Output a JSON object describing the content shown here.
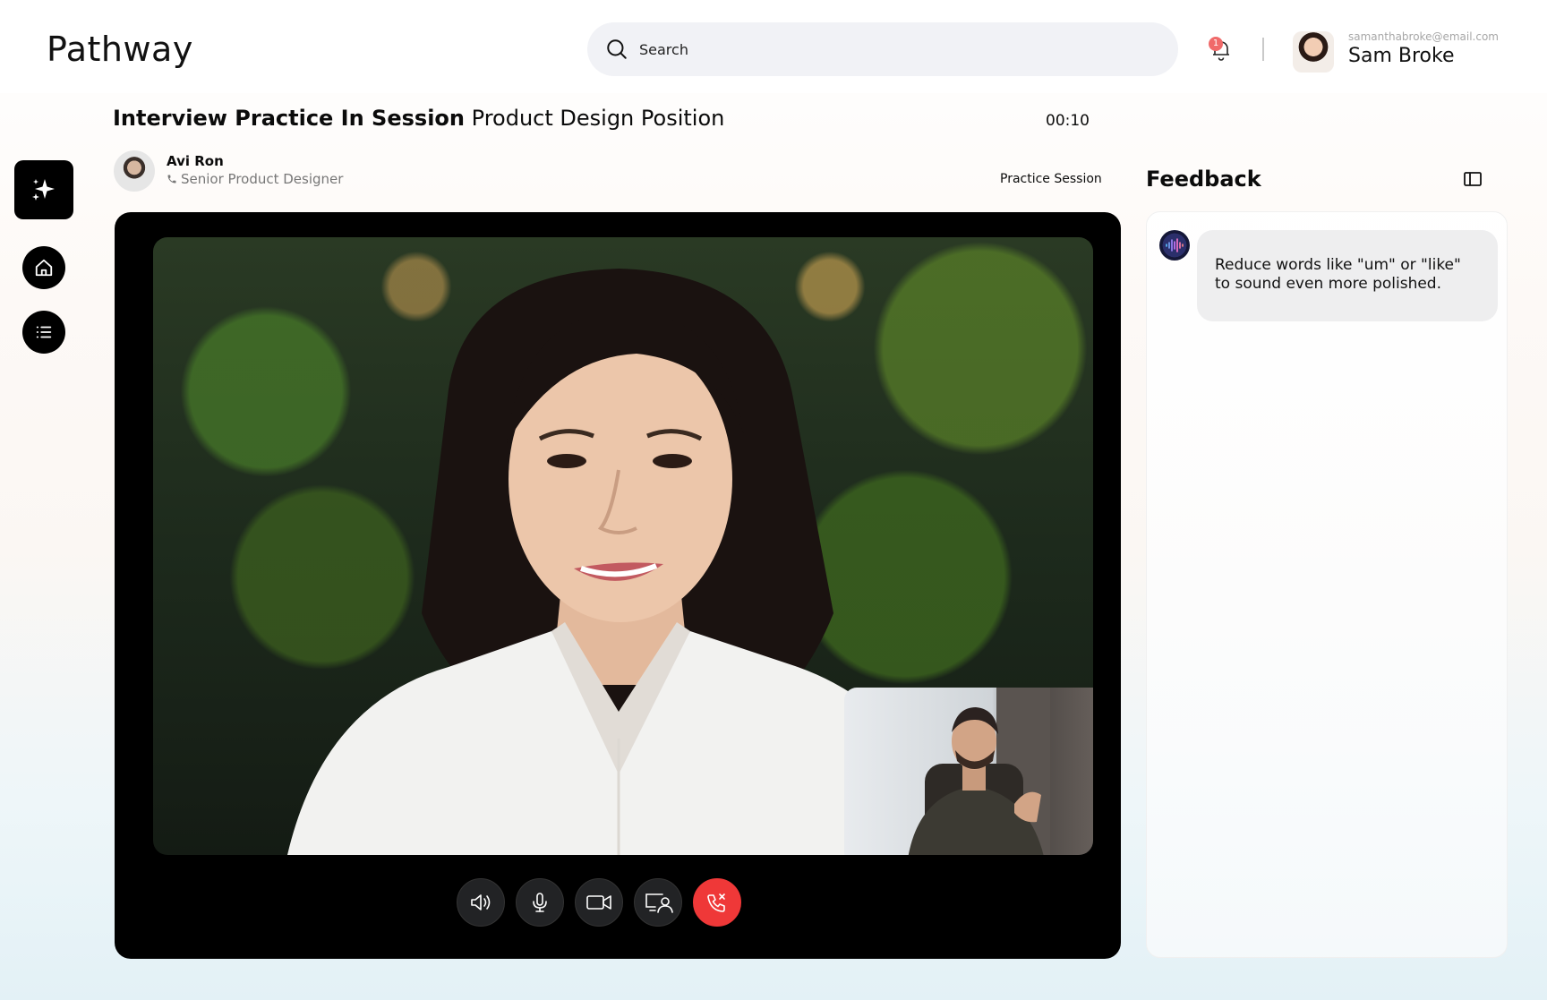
{
  "app": {
    "name": "Pathway"
  },
  "search": {
    "placeholder": "Search"
  },
  "notifications": {
    "count": "1"
  },
  "user": {
    "email": "samanthabroke@email.com",
    "name": "Sam Broke"
  },
  "session": {
    "title_bold": "Interview Practice In Session",
    "title_rest": "Product Design Position",
    "timer": "00:10",
    "label": "Practice Session"
  },
  "interviewer": {
    "name": "Avi Ron",
    "role": "Senior Product Designer"
  },
  "feedback": {
    "title": "Feedback",
    "messages": [
      {
        "text": "Reduce words like \"um\" or \"like\" to sound even more polished."
      }
    ]
  },
  "colors": {
    "end_call": "#ef3838",
    "badge": "#f06a6a",
    "rail": "#000000"
  }
}
